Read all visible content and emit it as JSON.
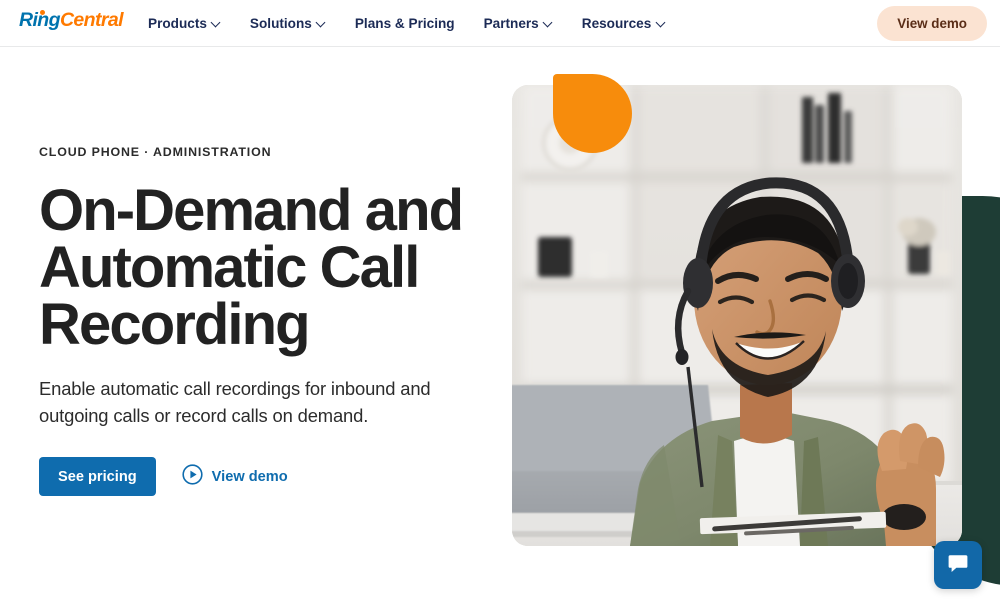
{
  "header": {
    "logo": {
      "part1": "Ring",
      "part2": "Central",
      "icon": "ringcentral-logo"
    },
    "nav": [
      {
        "label": "Products",
        "has_chevron": true
      },
      {
        "label": "Solutions",
        "has_chevron": true
      },
      {
        "label": "Plans & Pricing",
        "has_chevron": false
      },
      {
        "label": "Partners",
        "has_chevron": true
      },
      {
        "label": "Resources",
        "has_chevron": true
      }
    ],
    "cta_label": "View demo"
  },
  "hero": {
    "eyebrow": "CLOUD PHONE · ADMINISTRATION",
    "headline": "On-Demand and Automatic Call Recording",
    "subhead": "Enable automatic call recordings for inbound and outgoing calls or record calls on demand.",
    "primary_button": "See pricing",
    "secondary_link": "View demo",
    "secondary_icon": "play-circle-icon",
    "image_alt": "Smiling man wearing a headset working at a laptop"
  },
  "decor": {
    "orange_blob_color": "#F78C0C",
    "green_blob_color": "#1E3D35"
  },
  "chat": {
    "icon": "chat-bubble-icon",
    "label": "Chat"
  },
  "colors": {
    "brand_blue": "#0073AE",
    "brand_orange": "#FF7A00",
    "button_blue": "#0F6CAE",
    "header_cta_bg": "#FBE3D2",
    "nav_text": "#1C2B56"
  }
}
